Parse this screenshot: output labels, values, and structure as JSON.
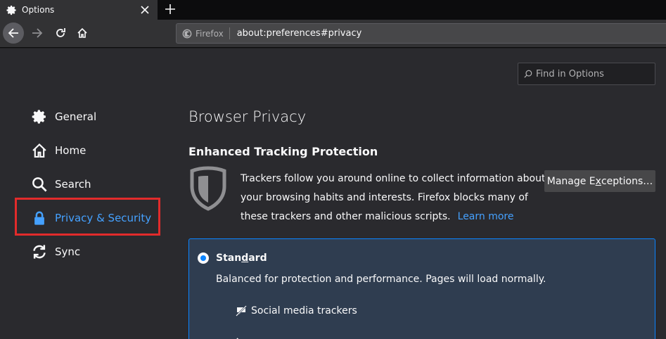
{
  "tab": {
    "title": "Options"
  },
  "urlbar": {
    "identity_label": "Firefox",
    "url": "about:preferences#privacy"
  },
  "find": {
    "placeholder": "Find in Options"
  },
  "sidebar": {
    "items": [
      {
        "label": "General",
        "icon": "gear-icon"
      },
      {
        "label": "Home",
        "icon": "home-icon"
      },
      {
        "label": "Search",
        "icon": "search-icon"
      },
      {
        "label": "Privacy & Security",
        "icon": "lock-icon",
        "selected": true
      },
      {
        "label": "Sync",
        "icon": "sync-icon"
      }
    ]
  },
  "main": {
    "page_title": "Browser Privacy",
    "section_title": "Enhanced Tracking Protection",
    "description": "Trackers follow you around online to collect information about your browsing habits and interests. Firefox blocks many of these trackers and other malicious scripts.",
    "learn_more": "Learn more",
    "exceptions_pre": "Manage E",
    "exceptions_ul": "x",
    "exceptions_post": "ceptions…"
  },
  "standard": {
    "label_pre": "Stan",
    "label_ul": "d",
    "label_post": "ard",
    "description": "Balanced for protection and performance. Pages will load normally.",
    "trackers": [
      "Social media trackers"
    ]
  },
  "colors": {
    "accent": "#0a84ff",
    "link": "#45a1ff",
    "highlight": "#e22b2b"
  }
}
